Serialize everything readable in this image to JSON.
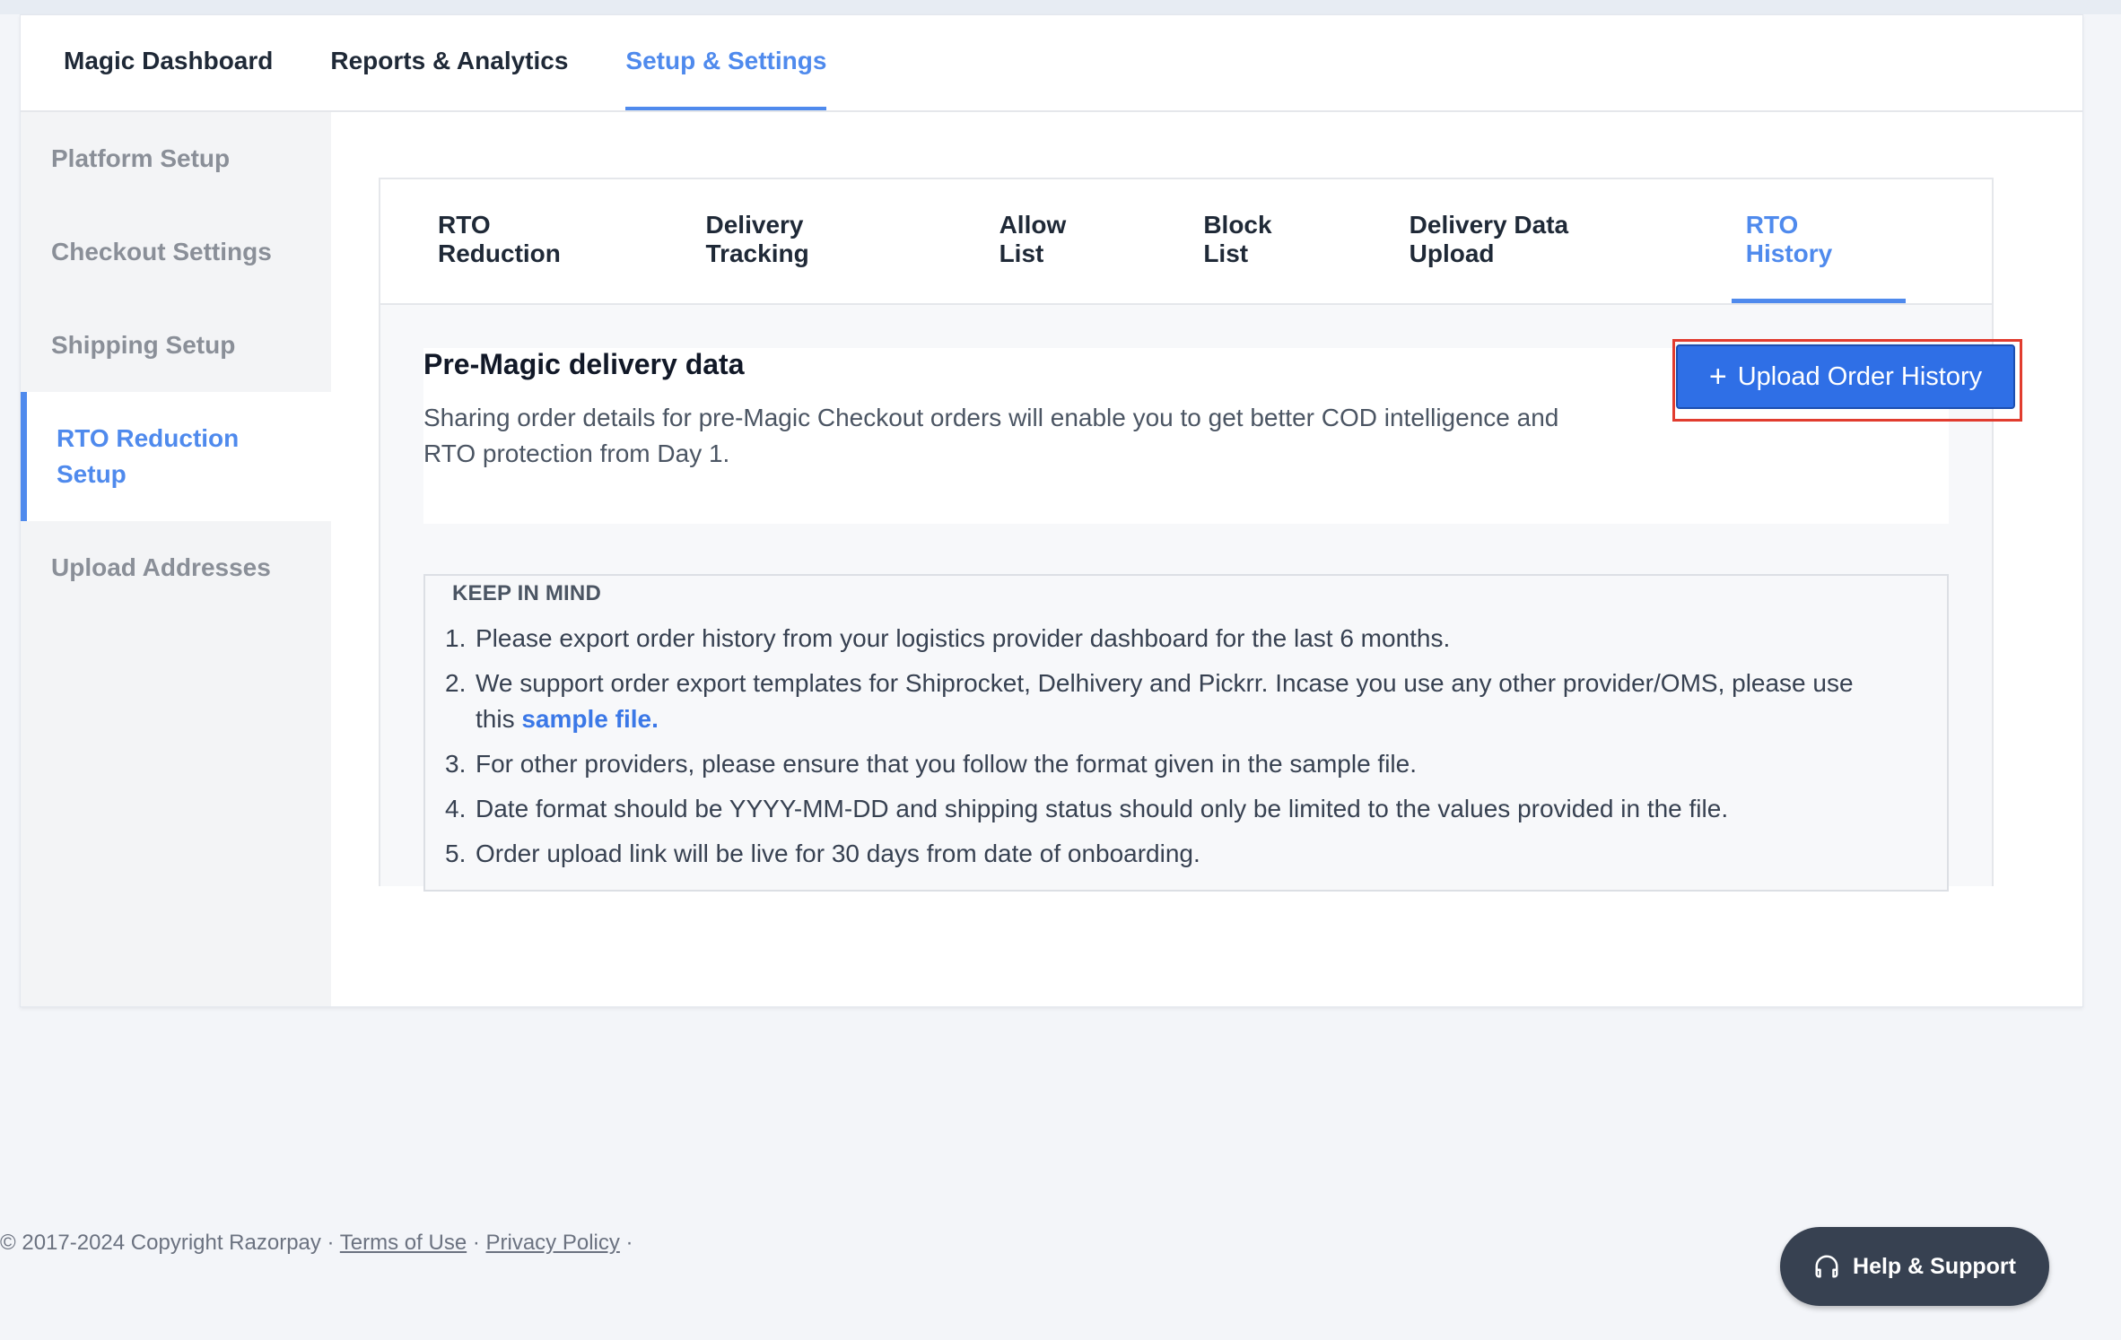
{
  "main_tabs": [
    {
      "label": "Magic Dashboard",
      "active": false
    },
    {
      "label": "Reports & Analytics",
      "active": false
    },
    {
      "label": "Setup & Settings",
      "active": true
    }
  ],
  "sidebar": {
    "items": [
      {
        "label": "Platform Setup"
      },
      {
        "label": "Checkout Settings"
      },
      {
        "label": "Shipping Setup"
      },
      {
        "label": "RTO Reduction Setup"
      },
      {
        "label": "Upload Addresses"
      }
    ]
  },
  "sub_tabs": [
    {
      "label": "RTO Reduction"
    },
    {
      "label": "Delivery Tracking"
    },
    {
      "label": "Allow List"
    },
    {
      "label": "Block List"
    },
    {
      "label": "Delivery Data Upload"
    },
    {
      "label": "RTO History"
    }
  ],
  "intro": {
    "title": "Pre-Magic delivery data",
    "description": "Sharing order details for pre-Magic Checkout orders will enable you to get better COD intelligence and RTO protection from Day 1.",
    "upload_button": "Upload Order History",
    "upload_icon": "+"
  },
  "keep_in_mind": {
    "title": "KEEP IN MIND",
    "items": [
      {
        "num": "1.",
        "text": "Please export order history from your logistics provider dashboard for the last 6 months."
      },
      {
        "num": "2.",
        "text": "We support order export templates for Shiprocket, Delhivery and Pickrr. Incase you use any other provider/OMS, please use this ",
        "link": "sample file."
      },
      {
        "num": "3.",
        "text": "For other providers, please ensure that you follow the format given in the sample file."
      },
      {
        "num": "4.",
        "text": "Date format should be YYYY-MM-DD and shipping status should only be limited to the values provided in the file."
      },
      {
        "num": "5.",
        "text": "Order upload link will be live for 30 days from date of onboarding."
      }
    ]
  },
  "footer": {
    "copyright": "© 2017-2024 Copyright Razorpay · ",
    "terms": "Terms of Use",
    "sep": " · ",
    "privacy": "Privacy Policy",
    "end": " ·"
  },
  "help": {
    "label": "Help & Support",
    "icon": "headphones-icon"
  },
  "colors": {
    "accent": "#4f8aed",
    "button": "#2f6fe6",
    "highlight": "#e13c2f",
    "help_bg": "#374151"
  }
}
